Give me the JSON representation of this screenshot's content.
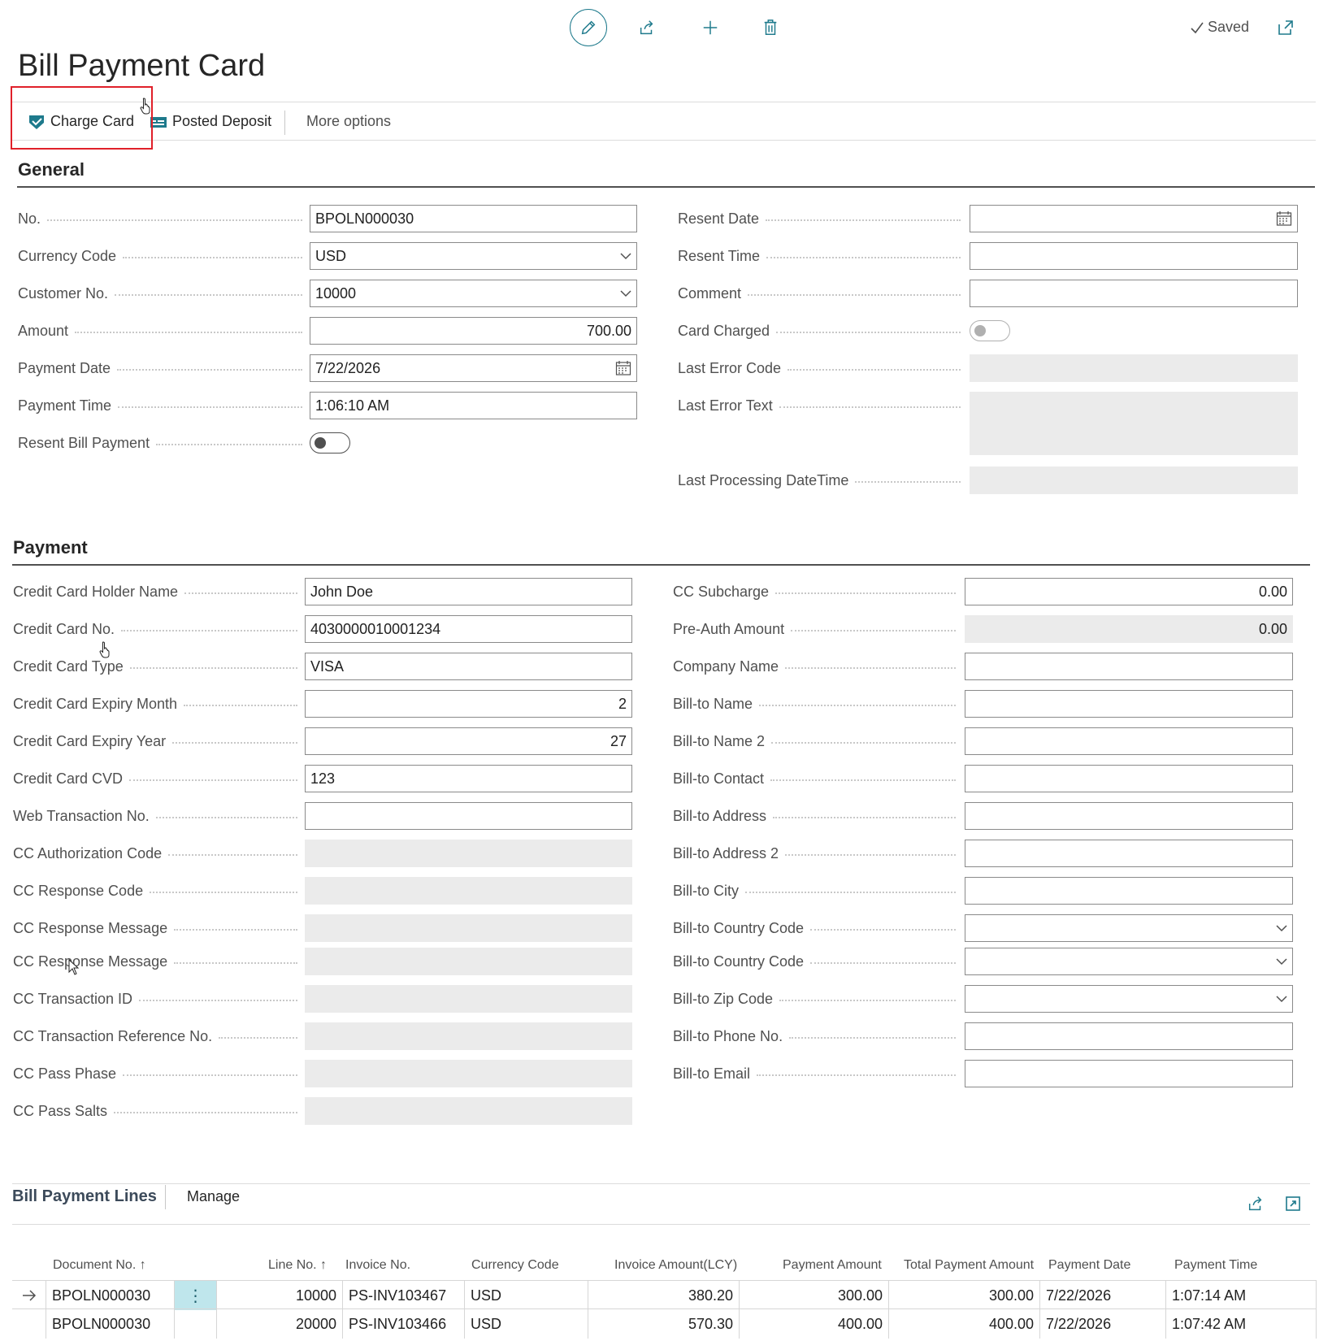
{
  "toolbar": {
    "edit_icon": "pencil-icon",
    "share_icon": "share-icon",
    "new_icon": "plus-icon",
    "delete_icon": "trash-icon",
    "saved_label": "Saved",
    "open_new_window_icon": "open-in-new-window-icon"
  },
  "page": {
    "title": "Bill Payment Card"
  },
  "actions": {
    "charge_card": "Charge Card",
    "posted_deposit": "Posted Deposit",
    "more_options": "More options"
  },
  "general": {
    "title": "General",
    "left": [
      {
        "label": "No.",
        "value": "BPOLN000030",
        "kind": "text"
      },
      {
        "label": "Currency Code",
        "value": "USD",
        "kind": "select"
      },
      {
        "label": "Customer No.",
        "value": "10000",
        "kind": "select"
      },
      {
        "label": "Amount",
        "value": "700.00",
        "kind": "number"
      },
      {
        "label": "Payment Date",
        "value": "7/22/2026",
        "kind": "date"
      },
      {
        "label": "Payment Time",
        "value": "1:06:10 AM",
        "kind": "text"
      },
      {
        "label": "Resent Bill Payment",
        "value": "off",
        "kind": "toggle"
      }
    ],
    "right": [
      {
        "label": "Resent Date",
        "value": "",
        "kind": "date"
      },
      {
        "label": "Resent Time",
        "value": "",
        "kind": "text"
      },
      {
        "label": "Comment",
        "value": "",
        "kind": "text"
      },
      {
        "label": "Card Charged",
        "value": "off",
        "kind": "toggle-disabled"
      },
      {
        "label": "Last Error Code",
        "value": "",
        "kind": "readonly"
      },
      {
        "label": "Last Error Text",
        "value": "",
        "kind": "readonly-tall"
      },
      {
        "label": "Last Processing DateTime",
        "value": "",
        "kind": "readonly"
      }
    ]
  },
  "payment": {
    "title": "Payment",
    "left": [
      {
        "label": "Credit Card Holder Name",
        "value": "John Doe",
        "kind": "text"
      },
      {
        "label": "Credit Card No.",
        "value": "4030000010001234",
        "kind": "text"
      },
      {
        "label": "Credit Card Type",
        "value": "VISA",
        "kind": "text"
      },
      {
        "label": "Credit Card Expiry Month",
        "value": "2",
        "kind": "number"
      },
      {
        "label": "Credit Card Expiry Year",
        "value": "27",
        "kind": "number"
      },
      {
        "label": "Credit Card CVD",
        "value": "123",
        "kind": "text"
      },
      {
        "label": "Web Transaction No.",
        "value": "",
        "kind": "text"
      },
      {
        "label": "CC Authorization Code",
        "value": "",
        "kind": "readonly"
      },
      {
        "label": "CC Response Code",
        "value": "",
        "kind": "readonly"
      },
      {
        "label": "CC Response Message",
        "value": "",
        "kind": "readonly"
      },
      {
        "label": "CC Response Message",
        "value": "",
        "kind": "readonly"
      },
      {
        "label": "CC Transaction ID",
        "value": "",
        "kind": "readonly"
      },
      {
        "label": "CC Transaction Reference No.",
        "value": "",
        "kind": "readonly"
      },
      {
        "label": "CC Pass Phase",
        "value": "",
        "kind": "readonly"
      },
      {
        "label": "CC Pass Salts",
        "value": "",
        "kind": "readonly"
      }
    ],
    "right": [
      {
        "label": "CC Subcharge",
        "value": "0.00",
        "kind": "number"
      },
      {
        "label": "Pre-Auth Amount",
        "value": "0.00",
        "kind": "readonly-number"
      },
      {
        "label": "Company Name",
        "value": "",
        "kind": "text"
      },
      {
        "label": "Bill-to Name",
        "value": "",
        "kind": "text"
      },
      {
        "label": "Bill-to Name 2",
        "value": "",
        "kind": "text"
      },
      {
        "label": "Bill-to Contact",
        "value": "",
        "kind": "text"
      },
      {
        "label": "Bill-to Address",
        "value": "",
        "kind": "text"
      },
      {
        "label": "Bill-to Address 2",
        "value": "",
        "kind": "text"
      },
      {
        "label": "Bill-to City",
        "value": "",
        "kind": "text"
      },
      {
        "label": "Bill-to Country Code",
        "value": "",
        "kind": "select"
      },
      {
        "label": "Bill-to Country Code",
        "value": "",
        "kind": "select"
      },
      {
        "label": "Bill-to Zip Code",
        "value": "",
        "kind": "select"
      },
      {
        "label": "Bill-to Phone No.",
        "value": "",
        "kind": "text"
      },
      {
        "label": "Bill-to Email",
        "value": "",
        "kind": "text"
      }
    ]
  },
  "lines": {
    "title": "Bill Payment Lines",
    "manage": "Manage",
    "columns": [
      "Document No. ↑",
      "Line No. ↑",
      "Invoice No.",
      "Currency Code",
      "Invoice Amount(LCY)",
      "Payment Amount",
      "Total Payment Amount",
      "Payment Date",
      "Payment Time"
    ],
    "rows": [
      {
        "current": true,
        "document_no": "BPOLN000030",
        "line_no": "10000",
        "invoice_no": "PS-INV103467",
        "currency": "USD",
        "invoice_amount": "380.20",
        "payment_amount": "300.00",
        "total_payment": "300.00",
        "payment_date": "7/22/2026",
        "payment_time": "1:07:14 AM"
      },
      {
        "current": false,
        "document_no": "BPOLN000030",
        "line_no": "20000",
        "invoice_no": "PS-INV103466",
        "currency": "USD",
        "invoice_amount": "570.30",
        "payment_amount": "400.00",
        "total_payment": "400.00",
        "payment_date": "7/22/2026",
        "payment_time": "1:07:42 AM"
      }
    ]
  },
  "colors": {
    "accent": "#1e7a8c",
    "highlight": "#e0202a",
    "readonly_bg": "#ebebeb",
    "row_menu_bg": "#bfe6ec"
  }
}
